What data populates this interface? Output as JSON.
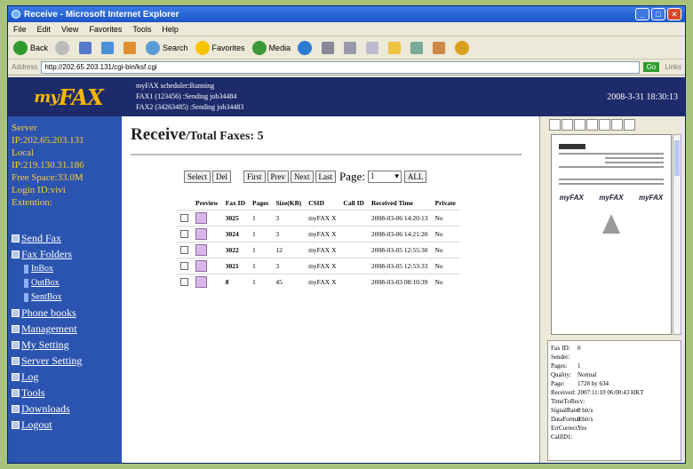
{
  "window": {
    "title": "Receive - Microsoft Internet Explorer"
  },
  "menu": [
    "File",
    "Edit",
    "View",
    "Favorites",
    "Tools",
    "Help"
  ],
  "toolbar": {
    "back": "Back",
    "search": "Search",
    "favorites": "Favorites",
    "media": "Media"
  },
  "address": {
    "label": "Address",
    "url": "http://202.65.203.131/cgi-bin/ksf.cgi",
    "go": "Go",
    "links": "Links"
  },
  "header": {
    "logo_prefix": "my",
    "logo": "FAX",
    "status_lines": [
      "myFAX scheduler:Running",
      "FAX1 (123456)   :Sending job34484",
      "FAX2 (34263485) :Sending job34483"
    ],
    "datetime": "2008-3-31 18:30:13"
  },
  "sidebar": {
    "info": [
      "Server",
      "IP:202.65.203.131",
      "Local",
      "IP:219.130.31.186",
      "Free Space:33.0M",
      "Login ID:vivi",
      "Extention:"
    ],
    "nav": [
      {
        "label": "Send Fax"
      },
      {
        "label": "Fax Folders"
      }
    ],
    "subnav": [
      "InBox",
      "OutBox",
      "SentBox"
    ],
    "nav2": [
      "Phone books",
      "Management",
      "My Setting",
      "Server Setting",
      "Log",
      "Tools",
      "Downloads",
      "Logout"
    ]
  },
  "main": {
    "title": "Receive",
    "subtitle": "/Total Faxes: 5",
    "buttons": {
      "select": "Select",
      "del": "Del",
      "first": "First",
      "prev": "Prev",
      "next": "Next",
      "last": "Last",
      "all": "ALL"
    },
    "page_label": "Page:",
    "page_value": "1",
    "columns": [
      "",
      "Preview",
      "Fax ID",
      "Pages",
      "Size(KB)",
      "CSID",
      "Call ID",
      "Received Time",
      "Private"
    ],
    "rows": [
      {
        "id": "3025",
        "pages": "1",
        "size": "3",
        "csid": "myFAX X",
        "callid": "",
        "time": "2008-03-06 14:20:13",
        "private": "No"
      },
      {
        "id": "3024",
        "pages": "1",
        "size": "3",
        "csid": "myFAX X",
        "callid": "",
        "time": "2008-03-06 14:21:20",
        "private": "No"
      },
      {
        "id": "3022",
        "pages": "1",
        "size": "12",
        "csid": "myFAX X",
        "callid": "",
        "time": "2008-03-05 12:55:30",
        "private": "No"
      },
      {
        "id": "3021",
        "pages": "1",
        "size": "3",
        "csid": "myFAX X",
        "callid": "",
        "time": "2008-03-05 12:53:33",
        "private": "No"
      },
      {
        "id": "8",
        "pages": "1",
        "size": "45",
        "csid": "myFAX X",
        "callid": "",
        "time": "2008-03-03 08:10:39",
        "private": "No"
      }
    ]
  },
  "preview": {
    "brands": [
      "myFAX",
      "myFAX",
      "myFAX"
    ],
    "props": [
      {
        "k": "Fax ID:",
        "v": "0"
      },
      {
        "k": "Sender:",
        "v": ""
      },
      {
        "k": "Pages:",
        "v": "1"
      },
      {
        "k": "Quality:",
        "v": "Normal"
      },
      {
        "k": "Page:",
        "v": "1728 by 634"
      },
      {
        "k": "Received:",
        "v": "2007:11:10 06:00:43 HKT"
      },
      {
        "k": "TimeToRecv:",
        "v": ""
      },
      {
        "k": "SignalRate:",
        "v": "0 bit/s"
      },
      {
        "k": "DataFormat:",
        "v": "0 bit/s"
      },
      {
        "k": "ErrCorrect:",
        "v": "Yes"
      },
      {
        "k": "CallID1:",
        "v": ""
      }
    ]
  }
}
